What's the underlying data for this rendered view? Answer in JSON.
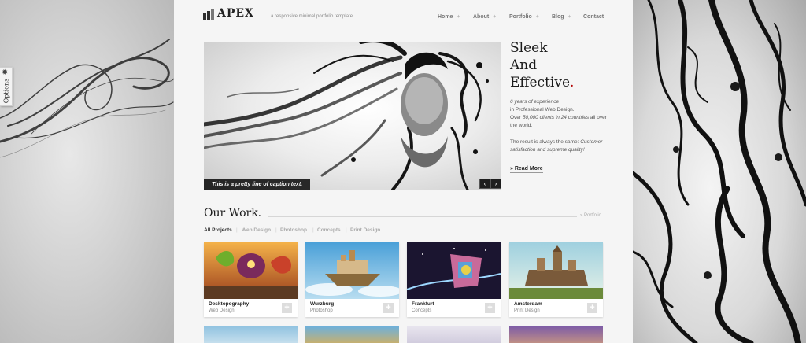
{
  "options_tab": {
    "label": "Options",
    "icon": "gear-icon"
  },
  "brand": {
    "name": "APEX",
    "tagline": "a responsive minimal portfolio template."
  },
  "nav": [
    {
      "label": "Home",
      "has_submenu": true
    },
    {
      "label": "About",
      "has_submenu": true
    },
    {
      "label": "Portfolio",
      "has_submenu": true
    },
    {
      "label": "Blog",
      "has_submenu": true
    },
    {
      "label": "Contact",
      "has_submenu": false
    }
  ],
  "nav_plus": "+",
  "hero": {
    "caption": "This is a pretty line of caption text.",
    "prev_label": "‹",
    "next_label": "›"
  },
  "headline": {
    "line1": "Sleek",
    "line2": "And",
    "line3": "Effective",
    "dot": "."
  },
  "intro": {
    "p1_italic": "6 years of experience",
    "p1_line2": "in Professional Web Design.",
    "p1_line3_pre": "Over ",
    "p1_line3_italic": "50,000 clients in 24 countries",
    "p1_line3_post": " all over the world.",
    "p2_pre": "The result is always the same: ",
    "p2_italic": "Customer satisfaction and supreme quality!"
  },
  "read_more": "» Read More",
  "work": {
    "title": "Our Work.",
    "link": "» Portfolio",
    "filters": [
      "All Projects",
      "Web Design",
      "Photoshop",
      "Concepts",
      "Print Design"
    ],
    "active_filter": "All Projects",
    "items": [
      {
        "title": "Desktopography",
        "category": "Web Design"
      },
      {
        "title": "Wurzburg",
        "category": "Photoshop"
      },
      {
        "title": "Frankfurt",
        "category": "Concepts"
      },
      {
        "title": "Amsterdam",
        "category": "Print Design"
      }
    ],
    "item_plus": "+"
  },
  "colors": {
    "accent": "#b20000",
    "page_bg": "#f5f5f5",
    "text": "#1a1a1a"
  }
}
